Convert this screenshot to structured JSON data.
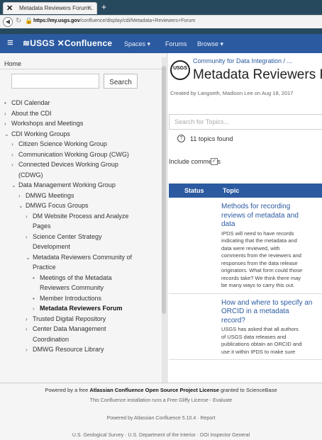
{
  "browser": {
    "tab_title": "Metadata Reviewers Forum...",
    "tab_icon": "confluence-x",
    "url_host": "https://my.usgs.gov",
    "url_path": "/confluence/display/cdi/Metadata+Reviewers+Forum"
  },
  "header": {
    "logo": "≋USGS ✕Confluence",
    "nav": [
      "Spaces ▾",
      "Forums",
      "Browse ▾"
    ]
  },
  "sidebar": {
    "home": "Home",
    "search_button": "Search",
    "tree": [
      {
        "mk": "•",
        "label": "CDI Calendar",
        "indent": 0
      },
      {
        "mk": "›",
        "label": "About the CDI",
        "indent": 0
      },
      {
        "mk": "›",
        "label": "Workshops and Meetings",
        "indent": 0
      },
      {
        "mk": "⌄",
        "label": "CDI Working Groups",
        "indent": 0
      },
      {
        "mk": "›",
        "label": "Citizen Science Working Group",
        "indent": 1
      },
      {
        "mk": "›",
        "label": "Communication Working Group (CWG)",
        "indent": 1
      },
      {
        "mk": "›",
        "label": "Connected Devices Working Group",
        "indent": 1
      },
      {
        "mk": "",
        "label": "(CDWG)",
        "indent": 1
      },
      {
        "mk": "⌄",
        "label": "Data Management Working Group",
        "indent": 1
      },
      {
        "mk": "›",
        "label": "DMWG Meetings",
        "indent": 2
      },
      {
        "mk": "⌄",
        "label": "DMWG Focus Groups",
        "indent": 2
      },
      {
        "mk": "›",
        "label": "DM Website Process and Analyze",
        "indent": 3
      },
      {
        "mk": "",
        "label": "Pages",
        "indent": 3
      },
      {
        "mk": "›",
        "label": "Science Center Strategy",
        "indent": 3
      },
      {
        "mk": "",
        "label": "Development",
        "indent": 3
      },
      {
        "mk": "⌄",
        "label": "Metadata Reviewers Community of",
        "indent": 3
      },
      {
        "mk": "",
        "label": "Practice",
        "indent": 3
      },
      {
        "mk": "•",
        "label": "Meetings of the Metadata",
        "indent": 4
      },
      {
        "mk": "",
        "label": "Reviewers Community",
        "indent": 4
      },
      {
        "mk": "•",
        "label": "Member Introductions",
        "indent": 4
      },
      {
        "mk": "›",
        "label": "Metadata Reviewers Forum",
        "indent": 4,
        "current": true
      },
      {
        "mk": "›",
        "label": "Trusted Digital Repository",
        "indent": 3
      },
      {
        "mk": "›",
        "label": "Center Data Management",
        "indent": 3
      },
      {
        "mk": "",
        "label": "Coordination",
        "indent": 3
      },
      {
        "mk": "›",
        "label": "DMWG Resource Library",
        "indent": 3
      }
    ]
  },
  "main": {
    "space_logo": "USGS",
    "breadcrumb": "Community for Data Integration / ...",
    "title": "Metadata Reviewers Forum",
    "byline": "Created by Langseth, Madison Lee on Aug 18, 2017",
    "search_placeholder": "Search for Topics...",
    "topics_found": "11 topics found",
    "include_comments": "Include comments",
    "col_status": "Status",
    "col_topic": "Topic",
    "topics": [
      {
        "title_lines": [
          "Methods for recording",
          "reviews of metadata and",
          "data"
        ],
        "desc_lines": [
          "IPDS will need to have records",
          "indicating that the metadata and",
          "data were reviewed, with",
          "comments from the reviewers and",
          "responses from the data release",
          "originators. What form could those",
          "records take? We think there may",
          "be many ways to carry this out."
        ]
      },
      {
        "title_lines": [
          "How and where to specify an",
          "ORCID in a metadata",
          "record?"
        ],
        "desc_lines": [
          "USGS has asked that all authors",
          "of USGS data releases and",
          "publications obtain an ORCID and",
          "use it within IPDS to make sure"
        ]
      }
    ]
  },
  "footer": {
    "line1_pre": "Powered by a free ",
    "line1_bold": "Atlassian Confluence Open Source Project License",
    "line1_post": " granted to ScienceBase",
    "line2": "This Confluence installation runs a Free Gliffy License - Evaluate",
    "line3": "Powered by Atlassian Confluence 5.10.4 · Report",
    "line4": "U.S. Geological Survey · U.S. Department of the Interior · DOI Inspector General"
  }
}
